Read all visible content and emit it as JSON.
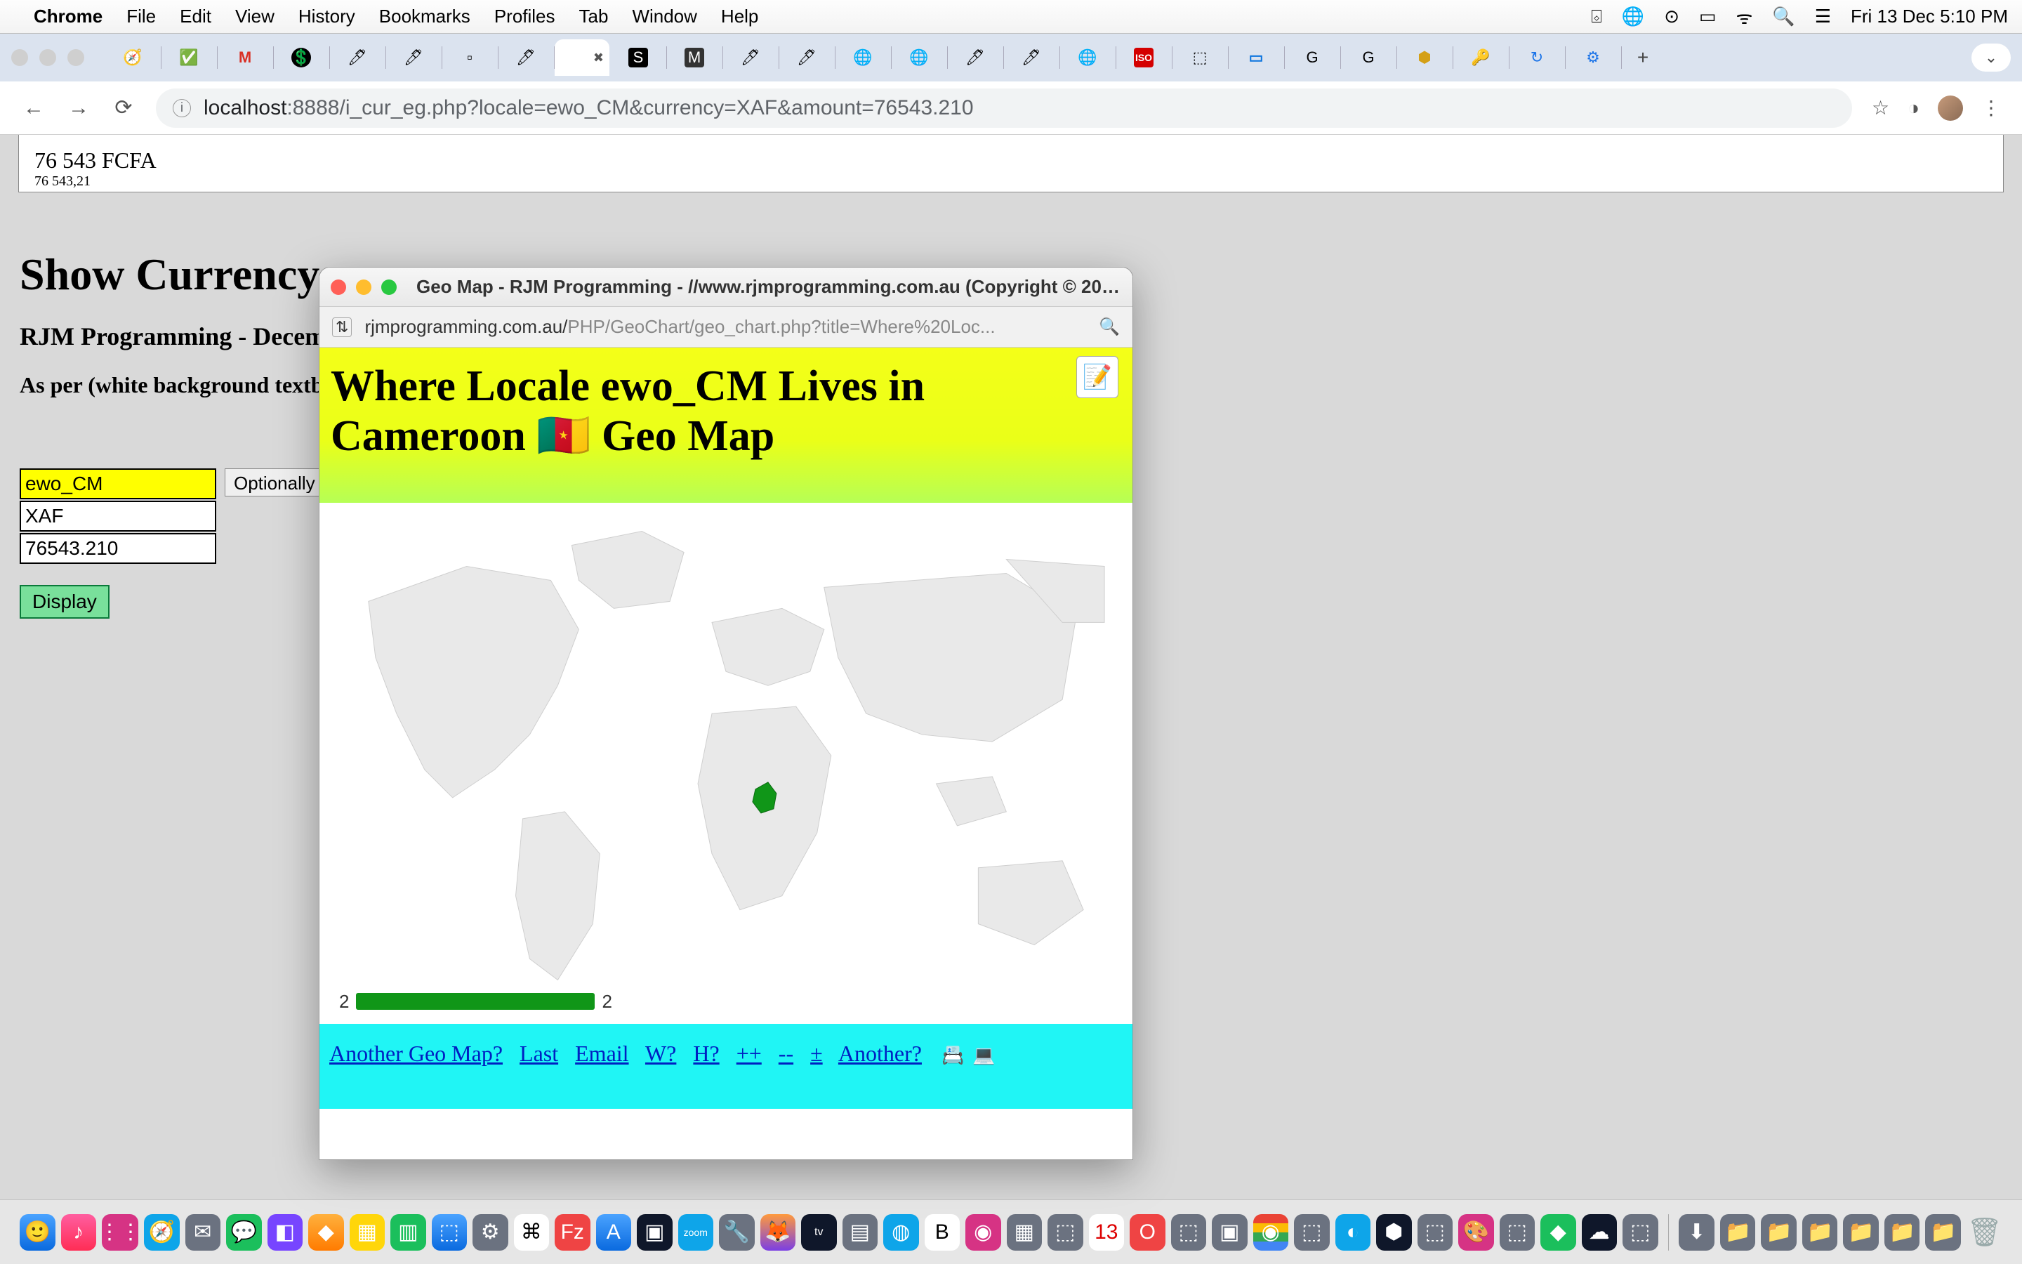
{
  "menubar": {
    "app": "Chrome",
    "items": [
      "File",
      "Edit",
      "View",
      "History",
      "Bookmarks",
      "Profiles",
      "Tab",
      "Window",
      "Help"
    ],
    "clock": "Fri 13 Dec  5:10 PM"
  },
  "toolbar": {
    "url_host": "localhost",
    "url_rest": ":8888/i_cur_eg.php?locale=ewo_CM&currency=XAF&amount=76543.210"
  },
  "page": {
    "fmt_big": "76 543 FCFA",
    "fmt_small": "76 543,21",
    "h1": "Show Currency",
    "sub": "RJM Programming - Decem",
    "asper": "As per (white background textbo",
    "locale": "ewo_CM",
    "currency": "XAF",
    "amount": "76543.210",
    "select_label": "Optionally :",
    "display_btn": "Display"
  },
  "popup": {
    "title": "Geo Map - RJM Programming - //www.rjmprogramming.com.au (Copyright © 201...",
    "url_plain": "rjmprogramming.com.au/",
    "url_dim": "PHP/GeoChart/geo_chart.php?title=Where%20Loc...",
    "heading_l1": "Where Locale ewo_CM Lives in",
    "heading_l2a": "Cameroon ",
    "heading_flag": "🇨🇲",
    "heading_l2b": " Geo Map",
    "legend_min": "2",
    "legend_max": "2",
    "footer_links": [
      "Another Geo Map?",
      "Last",
      "Email",
      "W?",
      "H?",
      "++",
      "--",
      "±",
      "Another?"
    ],
    "footer_icons": [
      "📇",
      "💻"
    ]
  },
  "tabs": {
    "icons": [
      "🧭",
      "✅",
      "M",
      "💲",
      "🖊",
      "🖊",
      "▫",
      "🖊",
      "✖",
      "S",
      "M",
      "🖊",
      "🖊",
      "🌐",
      "🌐",
      "🖊",
      "🖊",
      "🌐",
      "ISO",
      "⬚",
      "▭",
      "G",
      "G",
      "⬢",
      "🔑",
      "↻",
      "⚙"
    ]
  }
}
